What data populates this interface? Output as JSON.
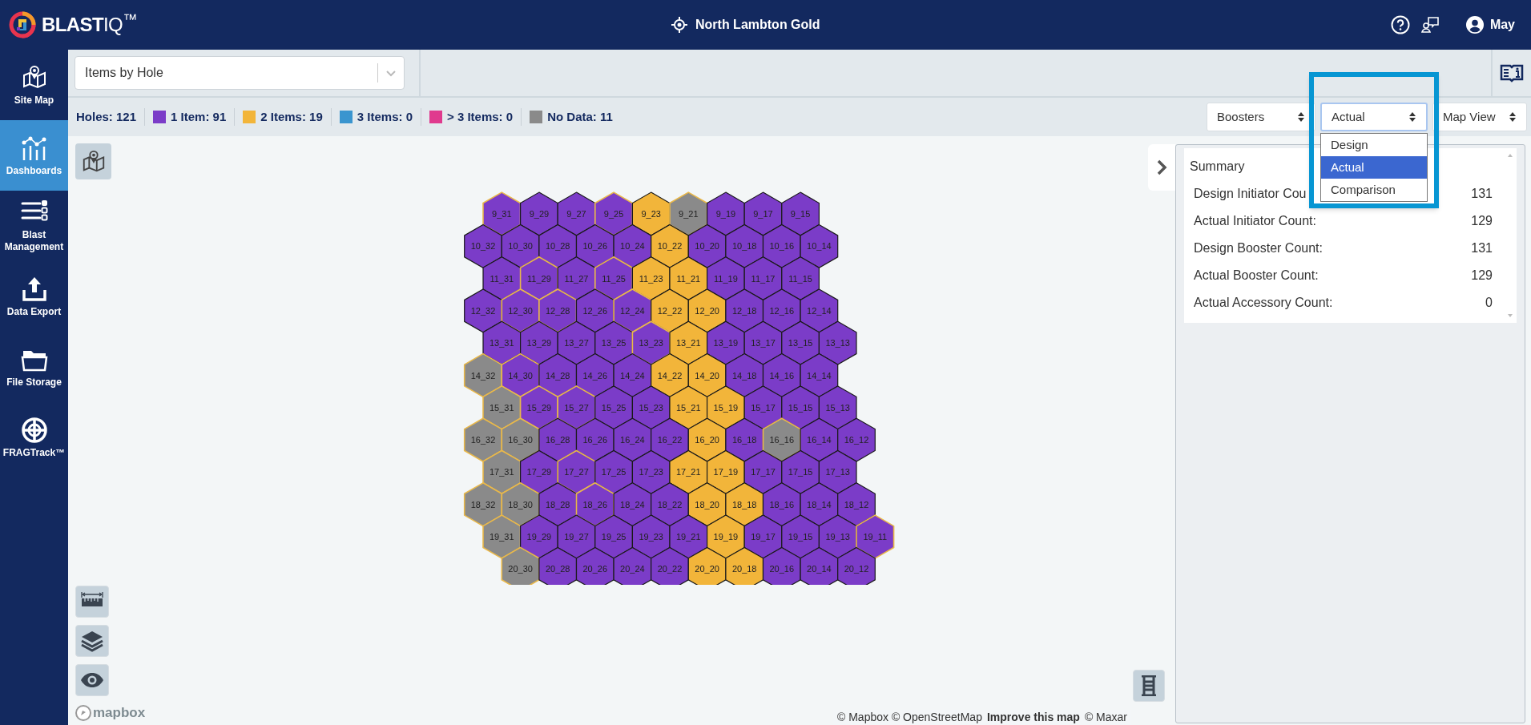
{
  "header": {
    "logo": "**BLAST**IQ$^{™}$",
    "site": "North Lambton Gold",
    "user": "May"
  },
  "sidebar": {
    "items": [
      {
        "label": "Site Map",
        "selected": false
      },
      {
        "label": "Dashboards",
        "selected": true
      },
      {
        "label": "Blast Management",
        "selected": false
      },
      {
        "label": "Data Export",
        "selected": false
      },
      {
        "label": "File Storage",
        "selected": false
      },
      {
        "label": "FRAGTrack™",
        "selected": false
      }
    ]
  },
  "view_select": {
    "value": "Items by Hole"
  },
  "legend": {
    "total": "Holes: 121",
    "items": [
      {
        "label": "1 Item: 91",
        "color": "#7b3cc8"
      },
      {
        "label": "2 Items: 19",
        "color": "#f2b53a"
      },
      {
        "label": "3 Items: 0",
        "color": "#3a95cf"
      },
      {
        "label": "> 3 Items: 0",
        "color": "#e03a8e"
      },
      {
        "label": "No Data: 11",
        "color": "#8a8a8a"
      }
    ]
  },
  "selects": [
    {
      "value": "Boosters",
      "expanded": false,
      "highlighted": false
    },
    {
      "value": "Actual",
      "expanded": true,
      "highlighted": true,
      "options": [
        {
          "label": "Design",
          "selected": false
        },
        {
          "label": "Actual",
          "selected": true
        },
        {
          "label": "Comparison",
          "selected": false
        }
      ]
    },
    {
      "value": "Map View",
      "expanded": false,
      "highlighted": false
    }
  ],
  "summary": {
    "title": "Summary",
    "rows": [
      {
        "label": "Design Initiator Cou",
        "value": "131"
      },
      {
        "label": "Actual Initiator Count:",
        "value": "129"
      },
      {
        "label": "Design Booster Count:",
        "value": "131"
      },
      {
        "label": "Actual Booster Count:",
        "value": "129"
      },
      {
        "label": "Actual Accessory Count:",
        "value": "0"
      }
    ]
  },
  "map": {
    "logo": "mapbox",
    "attribution": {
      "sources": "© Mapbox © OpenStreetMap",
      "link": "Improve this map",
      "imagery": "© Maxar"
    },
    "rows": [
      {
        "holes": [
          {
            "label": "9_31",
            "color": "#7b3cc8",
            "outlined": true
          },
          {
            "label": "9_29",
            "color": "#7b3cc8",
            "outlined": false
          },
          {
            "label": "9_27",
            "color": "#7b3cc8",
            "outlined": false
          },
          {
            "label": "9_25",
            "color": "#7b3cc8",
            "outlined": true
          },
          {
            "label": "9_23",
            "color": "#f2b53a",
            "outlined": false
          },
          {
            "label": "9_21",
            "color": "#8a8a8a",
            "outlined": true
          },
          {
            "label": "9_19",
            "color": "#7b3cc8",
            "outlined": false
          },
          {
            "label": "9_17",
            "color": "#7b3cc8",
            "outlined": false
          },
          {
            "label": "9_15",
            "color": "#7b3cc8",
            "outlined": false
          }
        ]
      },
      {
        "holes": [
          {
            "label": "10_32",
            "color": "#7b3cc8",
            "outlined": false
          },
          {
            "label": "10_30",
            "color": "#7b3cc8",
            "outlined": false
          },
          {
            "label": "10_28",
            "color": "#7b3cc8",
            "outlined": false
          },
          {
            "label": "10_26",
            "color": "#7b3cc8",
            "outlined": false
          },
          {
            "label": "10_24",
            "color": "#7b3cc8",
            "outlined": false
          },
          {
            "label": "10_22",
            "color": "#f2b53a",
            "outlined": false
          },
          {
            "label": "10_20",
            "color": "#7b3cc8",
            "outlined": false
          },
          {
            "label": "10_18",
            "color": "#7b3cc8",
            "outlined": false
          },
          {
            "label": "10_16",
            "color": "#7b3cc8",
            "outlined": false
          },
          {
            "label": "10_14",
            "color": "#7b3cc8",
            "outlined": false
          }
        ]
      },
      {
        "holes": [
          {
            "label": "11_31",
            "color": "#7b3cc8",
            "outlined": false
          },
          {
            "label": "11_29",
            "color": "#7b3cc8",
            "outlined": true
          },
          {
            "label": "11_27",
            "color": "#7b3cc8",
            "outlined": false
          },
          {
            "label": "11_25",
            "color": "#7b3cc8",
            "outlined": true
          },
          {
            "label": "11_23",
            "color": "#f2b53a",
            "outlined": false
          },
          {
            "label": "11_21",
            "color": "#f2b53a",
            "outlined": false
          },
          {
            "label": "11_19",
            "color": "#7b3cc8",
            "outlined": false
          },
          {
            "label": "11_17",
            "color": "#7b3cc8",
            "outlined": false
          },
          {
            "label": "11_15",
            "color": "#7b3cc8",
            "outlined": false
          }
        ]
      },
      {
        "holes": [
          {
            "label": "12_32",
            "color": "#7b3cc8",
            "outlined": false
          },
          {
            "label": "12_30",
            "color": "#7b3cc8",
            "outlined": true
          },
          {
            "label": "12_28",
            "color": "#7b3cc8",
            "outlined": true
          },
          {
            "label": "12_26",
            "color": "#7b3cc8",
            "outlined": false
          },
          {
            "label": "12_24",
            "color": "#7b3cc8",
            "outlined": true
          },
          {
            "label": "12_22",
            "color": "#f2b53a",
            "outlined": false
          },
          {
            "label": "12_20",
            "color": "#f2b53a",
            "outlined": false
          },
          {
            "label": "12_18",
            "color": "#7b3cc8",
            "outlined": false
          },
          {
            "label": "12_16",
            "color": "#7b3cc8",
            "outlined": false
          },
          {
            "label": "12_14",
            "color": "#7b3cc8",
            "outlined": false
          }
        ]
      },
      {
        "holes": [
          {
            "label": "13_31",
            "color": "#7b3cc8",
            "outlined": false
          },
          {
            "label": "13_29",
            "color": "#7b3cc8",
            "outlined": false
          },
          {
            "label": "13_27",
            "color": "#7b3cc8",
            "outlined": false
          },
          {
            "label": "13_25",
            "color": "#7b3cc8",
            "outlined": false
          },
          {
            "label": "13_23",
            "color": "#7b3cc8",
            "outlined": true
          },
          {
            "label": "13_21",
            "color": "#f2b53a",
            "outlined": false
          },
          {
            "label": "13_19",
            "color": "#7b3cc8",
            "outlined": false
          },
          {
            "label": "13_17",
            "color": "#7b3cc8",
            "outlined": false
          },
          {
            "label": "13_15",
            "color": "#7b3cc8",
            "outlined": false
          },
          {
            "label": "13_13",
            "color": "#7b3cc8",
            "outlined": false
          }
        ]
      },
      {
        "holes": [
          {
            "label": "14_32",
            "color": "#8a8a8a",
            "outlined": true
          },
          {
            "label": "14_30",
            "color": "#7b3cc8",
            "outlined": true
          },
          {
            "label": "14_28",
            "color": "#7b3cc8",
            "outlined": false
          },
          {
            "label": "14_26",
            "color": "#7b3cc8",
            "outlined": false
          },
          {
            "label": "14_24",
            "color": "#7b3cc8",
            "outlined": false
          },
          {
            "label": "14_22",
            "color": "#f2b53a",
            "outlined": false
          },
          {
            "label": "14_20",
            "color": "#f2b53a",
            "outlined": false
          },
          {
            "label": "14_18",
            "color": "#7b3cc8",
            "outlined": false
          },
          {
            "label": "14_16",
            "color": "#7b3cc8",
            "outlined": false
          },
          {
            "label": "14_14",
            "color": "#7b3cc8",
            "outlined": false
          }
        ]
      },
      {
        "holes": [
          {
            "label": "15_31",
            "color": "#8a8a8a",
            "outlined": true
          },
          {
            "label": "15_29",
            "color": "#7b3cc8",
            "outlined": true
          },
          {
            "label": "15_27",
            "color": "#7b3cc8",
            "outlined": true
          },
          {
            "label": "15_25",
            "color": "#7b3cc8",
            "outlined": false
          },
          {
            "label": "15_23",
            "color": "#7b3cc8",
            "outlined": false
          },
          {
            "label": "15_21",
            "color": "#f2b53a",
            "outlined": false
          },
          {
            "label": "15_19",
            "color": "#f2b53a",
            "outlined": false
          },
          {
            "label": "15_17",
            "color": "#7b3cc8",
            "outlined": false
          },
          {
            "label": "15_15",
            "color": "#7b3cc8",
            "outlined": false
          },
          {
            "label": "15_13",
            "color": "#7b3cc8",
            "outlined": false
          }
        ]
      },
      {
        "holes": [
          {
            "label": "16_32",
            "color": "#8a8a8a",
            "outlined": true
          },
          {
            "label": "16_30",
            "color": "#8a8a8a",
            "outlined": true
          },
          {
            "label": "16_28",
            "color": "#7b3cc8",
            "outlined": false
          },
          {
            "label": "16_26",
            "color": "#7b3cc8",
            "outlined": false
          },
          {
            "label": "16_24",
            "color": "#7b3cc8",
            "outlined": false
          },
          {
            "label": "16_22",
            "color": "#7b3cc8",
            "outlined": false
          },
          {
            "label": "16_20",
            "color": "#f2b53a",
            "outlined": false
          },
          {
            "label": "16_18",
            "color": "#7b3cc8",
            "outlined": false
          },
          {
            "label": "16_16",
            "color": "#8a8a8a",
            "outlined": true
          },
          {
            "label": "16_14",
            "color": "#7b3cc8",
            "outlined": false
          },
          {
            "label": "16_12",
            "color": "#7b3cc8",
            "outlined": false
          }
        ]
      },
      {
        "holes": [
          {
            "label": "17_31",
            "color": "#8a8a8a",
            "outlined": true
          },
          {
            "label": "17_29",
            "color": "#7b3cc8",
            "outlined": false
          },
          {
            "label": "17_27",
            "color": "#7b3cc8",
            "outlined": true
          },
          {
            "label": "17_25",
            "color": "#7b3cc8",
            "outlined": false
          },
          {
            "label": "17_23",
            "color": "#7b3cc8",
            "outlined": false
          },
          {
            "label": "17_21",
            "color": "#f2b53a",
            "outlined": false
          },
          {
            "label": "17_19",
            "color": "#f2b53a",
            "outlined": false
          },
          {
            "label": "17_17",
            "color": "#7b3cc8",
            "outlined": false
          },
          {
            "label": "17_15",
            "color": "#7b3cc8",
            "outlined": false
          },
          {
            "label": "17_13",
            "color": "#7b3cc8",
            "outlined": false
          }
        ]
      },
      {
        "holes": [
          {
            "label": "18_32",
            "color": "#8a8a8a",
            "outlined": true
          },
          {
            "label": "18_30",
            "color": "#8a8a8a",
            "outlined": true
          },
          {
            "label": "18_28",
            "color": "#7b3cc8",
            "outlined": false
          },
          {
            "label": "18_26",
            "color": "#7b3cc8",
            "outlined": true
          },
          {
            "label": "18_24",
            "color": "#7b3cc8",
            "outlined": false
          },
          {
            "label": "18_22",
            "color": "#7b3cc8",
            "outlined": false
          },
          {
            "label": "18_20",
            "color": "#f2b53a",
            "outlined": false
          },
          {
            "label": "18_18",
            "color": "#f2b53a",
            "outlined": false
          },
          {
            "label": "18_16",
            "color": "#7b3cc8",
            "outlined": false
          },
          {
            "label": "18_14",
            "color": "#7b3cc8",
            "outlined": false
          },
          {
            "label": "18_12",
            "color": "#7b3cc8",
            "outlined": false
          }
        ]
      },
      {
        "holes": [
          {
            "label": "19_31",
            "color": "#8a8a8a",
            "outlined": true
          },
          {
            "label": "19_29",
            "color": "#7b3cc8",
            "outlined": false
          },
          {
            "label": "19_27",
            "color": "#7b3cc8",
            "outlined": false
          },
          {
            "label": "19_25",
            "color": "#7b3cc8",
            "outlined": false
          },
          {
            "label": "19_23",
            "color": "#7b3cc8",
            "outlined": false
          },
          {
            "label": "19_21",
            "color": "#7b3cc8",
            "outlined": false
          },
          {
            "label": "19_19",
            "color": "#f2b53a",
            "outlined": false
          },
          {
            "label": "19_17",
            "color": "#7b3cc8",
            "outlined": false
          },
          {
            "label": "19_15",
            "color": "#7b3cc8",
            "outlined": false
          },
          {
            "label": "19_13",
            "color": "#7b3cc8",
            "outlined": false
          },
          {
            "label": "19_11",
            "color": "#7b3cc8",
            "outlined": true
          }
        ]
      },
      {
        "holes": [
          {
            "label": "20_30",
            "color": "#8a8a8a",
            "outlined": true
          },
          {
            "label": "20_28",
            "color": "#7b3cc8",
            "outlined": false
          },
          {
            "label": "20_26",
            "color": "#7b3cc8",
            "outlined": false
          },
          {
            "label": "20_24",
            "color": "#7b3cc8",
            "outlined": false
          },
          {
            "label": "20_22",
            "color": "#7b3cc8",
            "outlined": false
          },
          {
            "label": "20_20",
            "color": "#f2b53a",
            "outlined": false
          },
          {
            "label": "20_18",
            "color": "#f2b53a",
            "outlined": false
          },
          {
            "label": "20_16",
            "color": "#7b3cc8",
            "outlined": false
          },
          {
            "label": "20_14",
            "color": "#7b3cc8",
            "outlined": false
          },
          {
            "label": "20_12",
            "color": "#7b3cc8",
            "outlined": false
          }
        ]
      }
    ]
  }
}
